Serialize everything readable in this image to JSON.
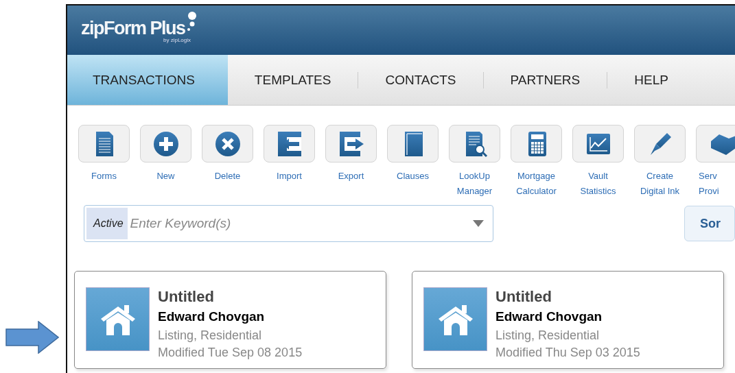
{
  "header": {
    "logo": "zipForm Plus",
    "logo_byline": "by zipLogix"
  },
  "tabs": [
    {
      "label": "TRANSACTIONS",
      "selected": true
    },
    {
      "label": "TEMPLATES",
      "selected": false
    },
    {
      "label": "CONTACTS",
      "selected": false
    },
    {
      "label": "PARTNERS",
      "selected": false
    },
    {
      "label": "HELP",
      "selected": false
    }
  ],
  "toolbar": [
    {
      "label": [
        "Forms"
      ]
    },
    {
      "label": [
        "New"
      ]
    },
    {
      "label": [
        "Delete"
      ]
    },
    {
      "label": [
        "Import"
      ]
    },
    {
      "label": [
        "Export"
      ]
    },
    {
      "label": [
        "Clauses"
      ]
    },
    {
      "label": [
        "LookUp",
        "Manager"
      ]
    },
    {
      "label": [
        "Mortgage",
        "Calculator"
      ]
    },
    {
      "label": [
        "Vault",
        "Statistics"
      ]
    },
    {
      "label": [
        "Create",
        "Digital Ink"
      ]
    },
    {
      "label": [
        "Serv",
        "Provi"
      ]
    }
  ],
  "search": {
    "filter": "Active",
    "placeholder": "Enter Keyword(s)",
    "button": "Sor"
  },
  "cards": [
    {
      "title": "Untitled",
      "name": "Edward Chovgan",
      "type": "Listing, Residential",
      "modified": "Modified Tue Sep 08 2015"
    },
    {
      "title": "Untitled",
      "name": "Edward Chovgan",
      "type": "Listing, Residential",
      "modified": "Modified Thu Sep 03 2015"
    }
  ]
}
